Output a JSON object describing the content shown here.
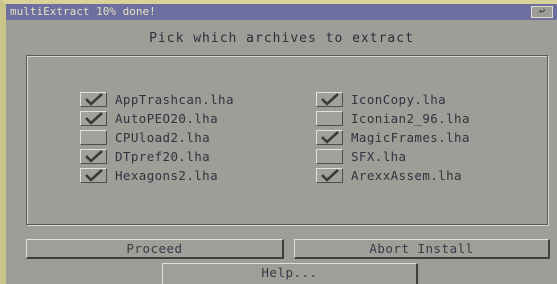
{
  "window": {
    "title": "multiExtract 10% done!"
  },
  "heading": "Pick which archives to extract",
  "archives_left": [
    {
      "label": "AppTrashcan.lha",
      "checked": true
    },
    {
      "label": "AutoPEO20.lha",
      "checked": true
    },
    {
      "label": "CPUload2.lha",
      "checked": false
    },
    {
      "label": "DTpref20.lha",
      "checked": true
    },
    {
      "label": "Hexagons2.lha",
      "checked": true
    }
  ],
  "archives_right": [
    {
      "label": "IconCopy.lha",
      "checked": true
    },
    {
      "label": "Iconian2_96.lha",
      "checked": false
    },
    {
      "label": "MagicFrames.lha",
      "checked": true
    },
    {
      "label": "SFX.lha",
      "checked": false
    },
    {
      "label": "ArexxAssem.lha",
      "checked": true
    }
  ],
  "buttons": {
    "proceed": "Proceed",
    "abort": "Abort Install",
    "help": "Help..."
  },
  "icons": {
    "checkmark": "checkmark-icon",
    "close": "window-depth-icon"
  },
  "colors": {
    "titlebar": "#6d6fa0",
    "background": "#9f9d97",
    "checkmark": "#3a3a3a"
  }
}
